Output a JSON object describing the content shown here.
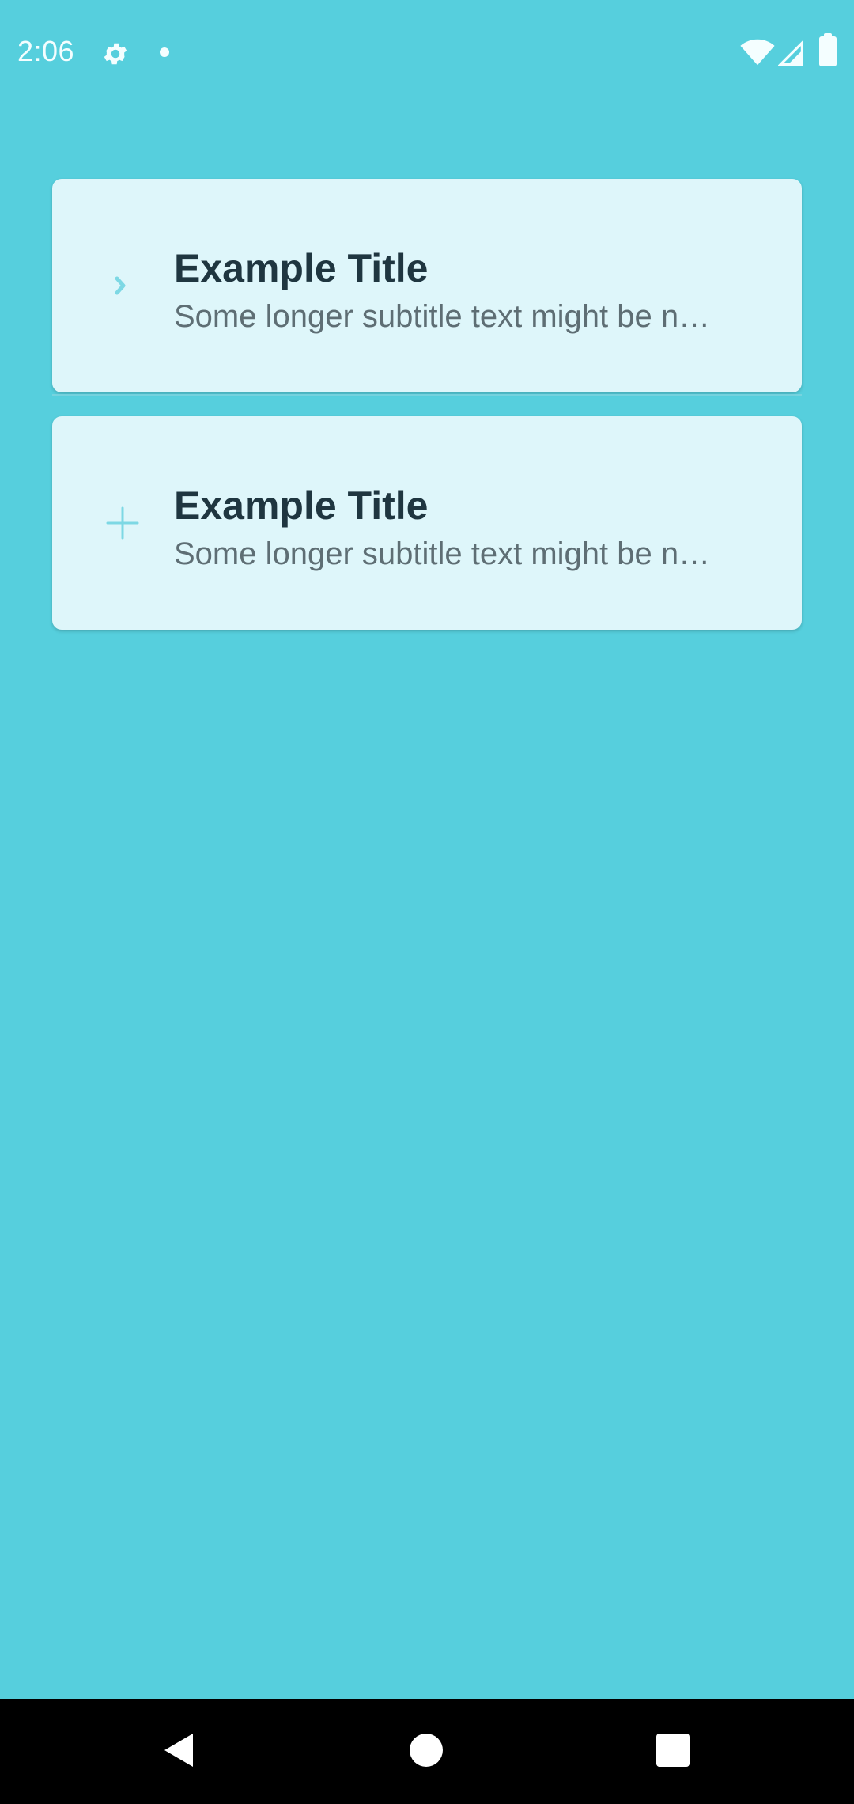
{
  "status_bar": {
    "time": "2:06",
    "icons": [
      "gear-icon",
      "notification-dot-icon",
      "wifi-icon",
      "signal-icon",
      "battery-icon"
    ]
  },
  "list": {
    "items": [
      {
        "icon": "chevron-right-icon",
        "title": "Example Title",
        "subtitle": "Some longer subtitle text might be n…"
      },
      {
        "icon": "plus-icon",
        "title": "Example Title",
        "subtitle": "Some longer subtitle text might be n…"
      }
    ]
  },
  "nav_bar": {
    "icons": [
      "back-icon",
      "home-icon",
      "recents-icon"
    ]
  },
  "colors": {
    "background": "#56CFDD",
    "card": "#DEF6FA",
    "title": "#1F3640",
    "subtitle": "#5E6E74",
    "icon_accent": "#7DD8E4"
  }
}
